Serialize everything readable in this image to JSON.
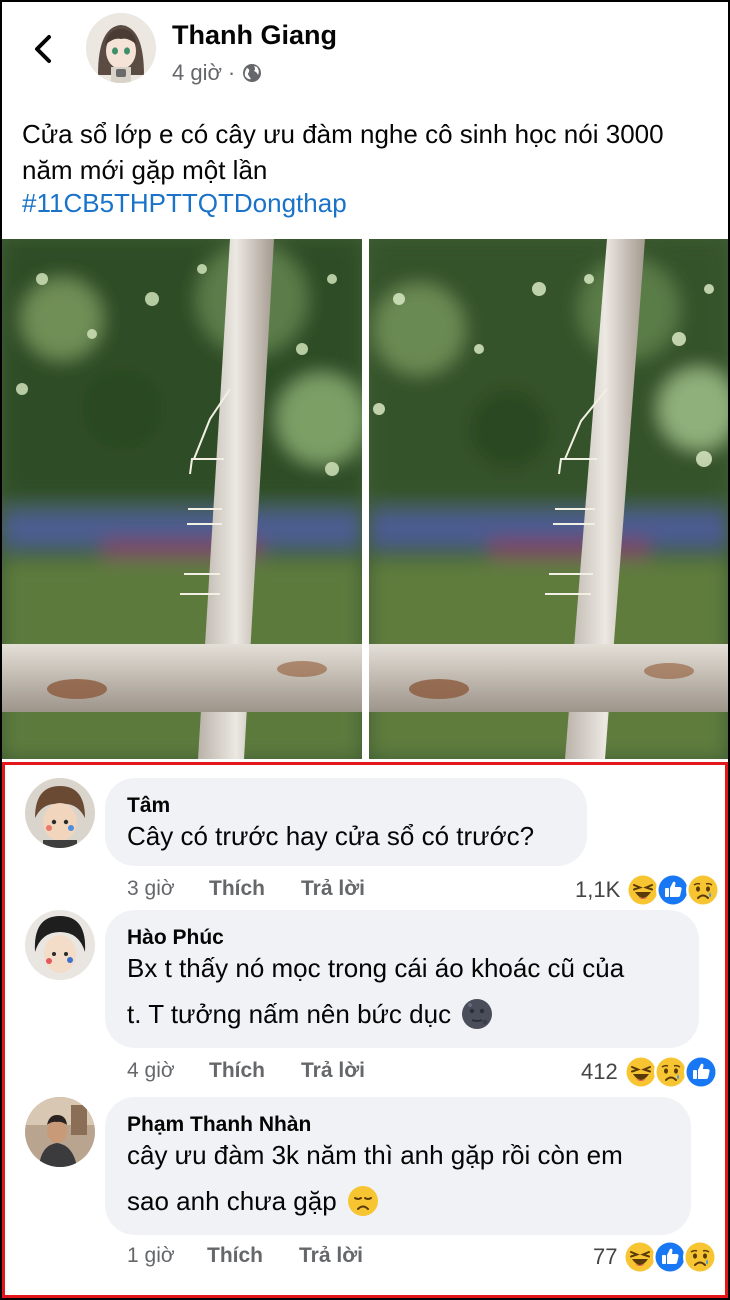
{
  "post": {
    "author": "Thanh Giang",
    "time": "4 giờ",
    "separator": "·",
    "text": "Cửa sổ lớp e có cây ưu đàm nghe cô sinh học nói 3000 năm mới gặp một lần",
    "hashtag": "#11CB5THPTTQTDongthap"
  },
  "comments": [
    {
      "name": "Tâm",
      "text": "Cây có trước hay cửa sổ có trước?",
      "time": "3 giờ",
      "like_label": "Thích",
      "reply_label": "Trả lời",
      "reaction_count": "1,1K",
      "reactions": [
        "haha",
        "like",
        "sad"
      ]
    },
    {
      "name": "Hào Phúc",
      "text_line1": "Bx t thấy nó mọc trong cái áo khoác cũ của",
      "text_line2": "t.  T tưởng nấm nên bức dục",
      "emoji": "new-moon-face",
      "time": "4 giờ",
      "like_label": "Thích",
      "reply_label": "Trả lời",
      "reaction_count": "412",
      "reactions": [
        "haha",
        "sad",
        "like"
      ]
    },
    {
      "name": "Phạm Thanh Nhàn",
      "text_line1": "cây ưu đàm 3k năm thì anh gặp rồi còn em",
      "text_line2": "sao anh chưa gặp",
      "emoji": "disappointed-face",
      "time": "1 giờ",
      "like_label": "Thích",
      "reply_label": "Trả lời",
      "reaction_count": "77",
      "reactions": [
        "haha",
        "like",
        "sad"
      ]
    }
  ],
  "colors": {
    "link": "#1a73c8",
    "bubble": "#f0f2f5",
    "highlight_border": "#e2161b",
    "like": "#1877f2",
    "haha": "#f7c531"
  }
}
